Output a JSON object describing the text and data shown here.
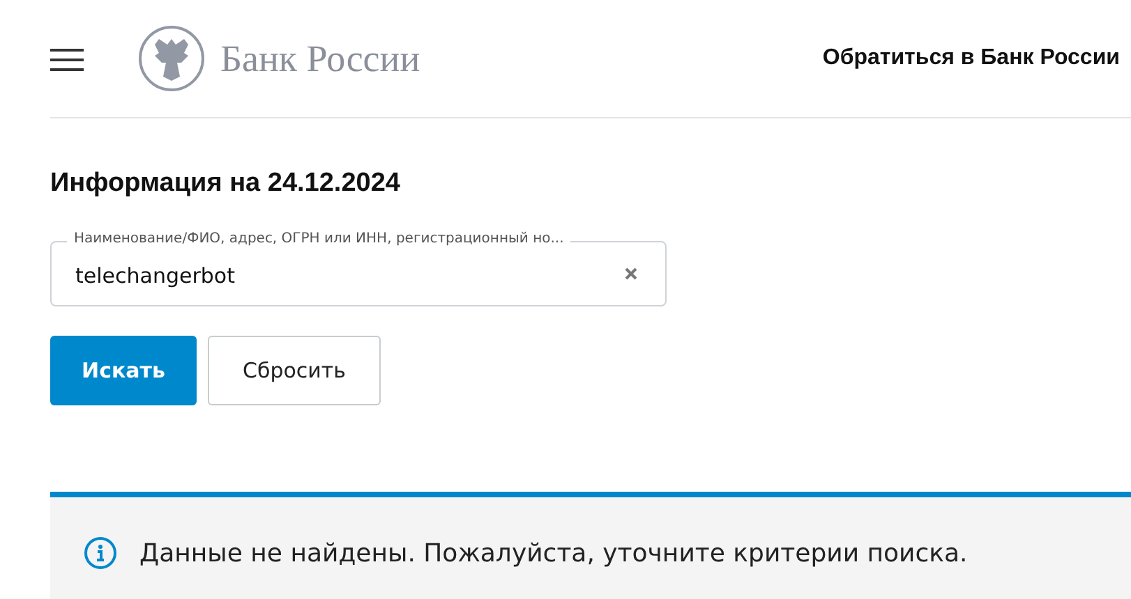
{
  "header": {
    "logo_text": "Банк России",
    "contact_link": "Обратиться в Банк России"
  },
  "title": "Информация на 24.12.2024",
  "search": {
    "label": "Наименование/ФИО, адрес, ОГРН или ИНН, регистрационный но...",
    "value": "telechangerbot"
  },
  "buttons": [
    {
      "label": "Искать",
      "kind": "primary"
    },
    {
      "label": "Сбросить",
      "kind": "secondary"
    }
  ],
  "notice": {
    "text": "Данные не найдены. Пожалуйста, уточните критерии поиска."
  }
}
